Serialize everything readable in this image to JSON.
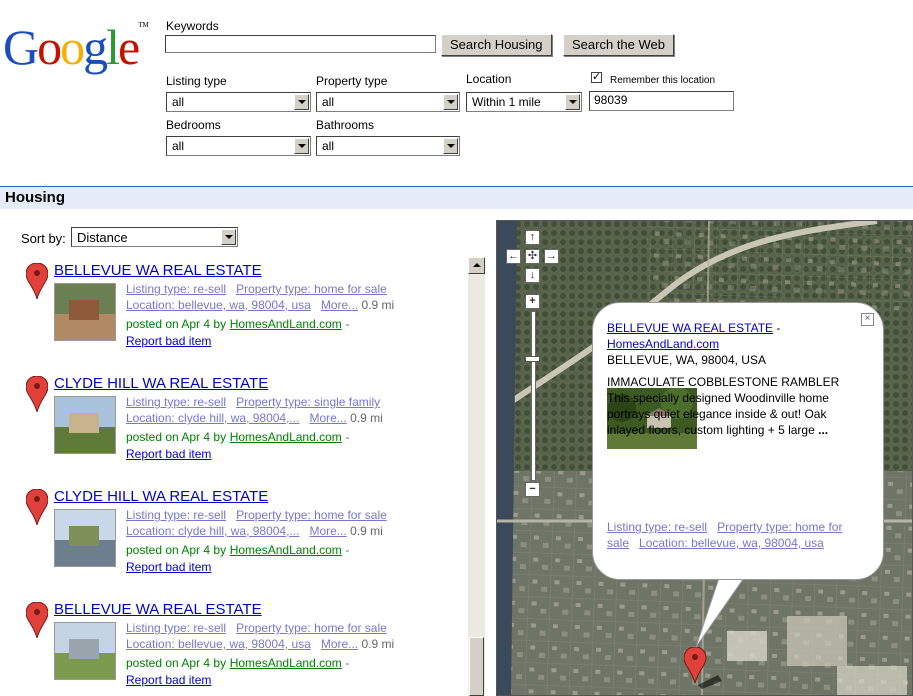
{
  "logo": {
    "text": "Google",
    "tm": "TM",
    "letters": [
      "G",
      "o",
      "o",
      "g",
      "l",
      "e"
    ],
    "colors": [
      "#1b4ebd",
      "#c41200",
      "#f3b000",
      "#1b4ebd",
      "#2c9a34",
      "#c41200"
    ]
  },
  "search": {
    "keywords_label": "Keywords",
    "keywords_value": "",
    "search_housing_label": "Search Housing",
    "search_web_label": "Search the Web"
  },
  "filters": {
    "listing_type_label": "Listing type",
    "listing_type_value": "all",
    "property_type_label": "Property type",
    "property_type_value": "all",
    "location_label": "Location",
    "location_value": "Within 1 mile",
    "remember_label": "Remember this location",
    "remember_checked": true,
    "zip_value": "98039",
    "bedrooms_label": "Bedrooms",
    "bedrooms_value": "all",
    "bathrooms_label": "Bathrooms",
    "bathrooms_value": "all"
  },
  "section_title": "Housing",
  "sort": {
    "label": "Sort by:",
    "value": "Distance"
  },
  "results": [
    {
      "title": "BELLEVUE WA REAL ESTATE",
      "listing_type": "Listing type: re-sell",
      "property_type": "Property type: home for sale",
      "location": "Location: bellevue, wa, 98004, usa",
      "more": "More...",
      "distance": "0.9 mi",
      "posted": "posted on Apr 4 by",
      "poster": "HomesAndLand.com",
      "dash": "-",
      "report": "Report bad item"
    },
    {
      "title": "CLYDE HILL WA REAL ESTATE",
      "listing_type": "Listing type: re-sell",
      "property_type": "Property type: single family",
      "location": "Location: clyde hill, wa, 98004,...",
      "more": "More...",
      "distance": "0.9 mi",
      "posted": "posted on Apr 4 by",
      "poster": "HomesAndLand.com",
      "dash": "-",
      "report": "Report bad item"
    },
    {
      "title": "CLYDE HILL WA REAL ESTATE",
      "listing_type": "Listing type: re-sell",
      "property_type": "Property type: home for sale",
      "location": "Location: clyde hill, wa, 98004,...",
      "more": "More...",
      "distance": "0.9 mi",
      "posted": "posted on Apr 4 by",
      "poster": "HomesAndLand.com",
      "dash": "-",
      "report": "Report bad item"
    },
    {
      "title": "BELLEVUE WA REAL ESTATE",
      "listing_type": "Listing type: re-sell",
      "property_type": "Property type: home for sale",
      "location": "Location: bellevue, wa, 98004, usa",
      "more": "More...",
      "distance": "0.9 mi",
      "posted": "posted on Apr 4 by",
      "poster": "HomesAndLand.com",
      "dash": "-",
      "report": "Report bad item"
    }
  ],
  "popup": {
    "title": "BELLEVUE WA REAL ESTATE",
    "sep": " - ",
    "source": "HomesAndLand.com",
    "address": "BELLEVUE, WA, 98004, USA",
    "description": "IMMACULATE COBBLESTONE RAMBLER This specially designed Woodinville home portrays quiet elegance inside & out! Oak inlayed floors, custom lighting + 5 large",
    "ellipsis": "...",
    "listing_type": "Listing type: re-sell",
    "property_type": "Property type: home for sale",
    "location": "Location: bellevue, wa, 98004, usa",
    "close": "×"
  },
  "map_controls": {
    "up": "↑",
    "left": "←",
    "center": "✣",
    "right": "→",
    "down": "↓",
    "zoom_in": "+",
    "zoom_out": "−"
  },
  "colors": {
    "link": "#0000cc",
    "visited_meta": "#7777cc",
    "green": "#008000",
    "housing_bar": "#e5ecf9",
    "marker": "#e0413b"
  }
}
